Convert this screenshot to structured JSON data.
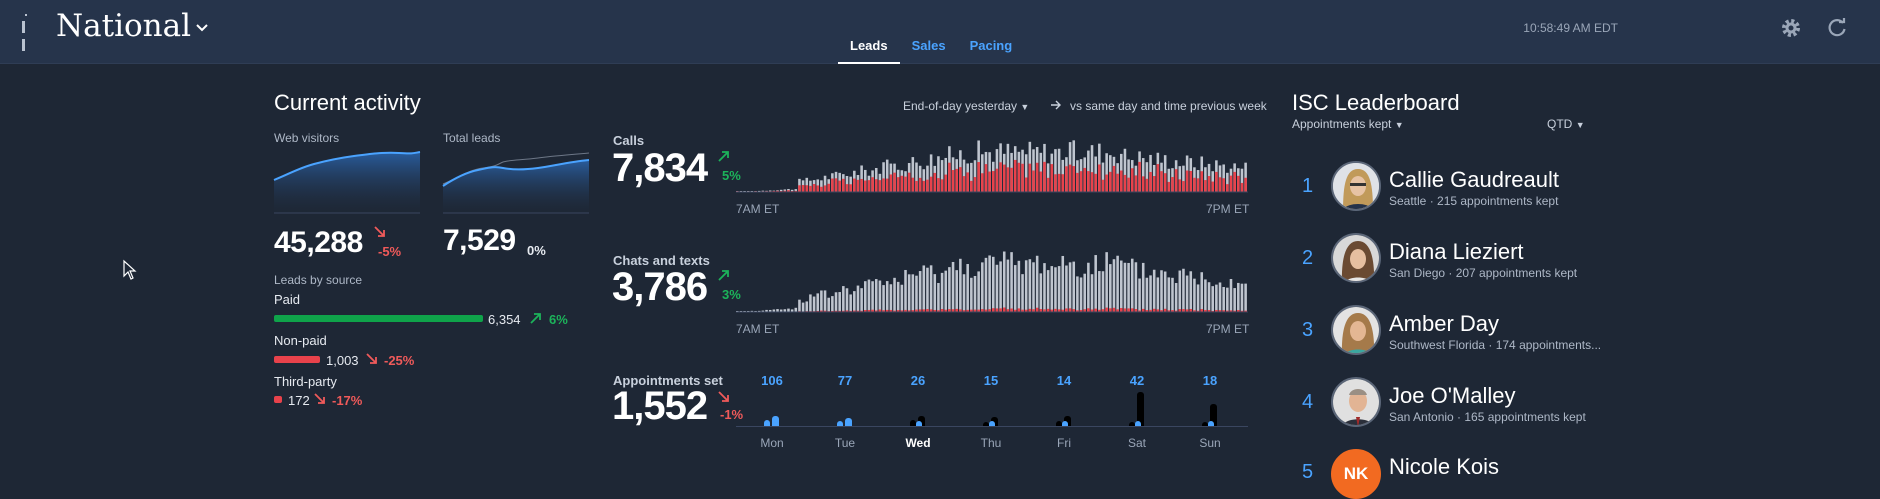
{
  "header": {
    "region": "National",
    "tabs": [
      {
        "label": "Leads",
        "active": true
      },
      {
        "label": "Sales",
        "active": false
      },
      {
        "label": "Pacing",
        "active": false
      }
    ],
    "time": "10:58:49 AM EDT"
  },
  "activity": {
    "title": "Current activity",
    "period": "End-of-day yesterday",
    "comparison": "vs same day and time previous week",
    "web_visitors": {
      "label": "Web visitors",
      "value": "45,288",
      "change": "-5%",
      "trend": "down"
    },
    "total_leads": {
      "label": "Total leads",
      "value": "7,529",
      "change": "0%",
      "trend": "flat"
    },
    "sources_title": "Leads by source",
    "sources": [
      {
        "label": "Paid",
        "value": "6,354",
        "change": "6%",
        "trend": "up",
        "color": "#0fa34a",
        "share": 1.0
      },
      {
        "label": "Non-paid",
        "value": "1,003",
        "change": "-25%",
        "trend": "down",
        "color": "#e8424b",
        "share": 0.22
      },
      {
        "label": "Third-party",
        "value": "172",
        "change": "-17%",
        "trend": "down",
        "color": "#e8424b",
        "share": 0.04
      }
    ],
    "calls": {
      "label": "Calls",
      "value": "7,834",
      "change": "5%",
      "trend": "up",
      "axis_start": "7AM ET",
      "axis_end": "7PM ET"
    },
    "chats": {
      "label": "Chats and texts",
      "value": "3,786",
      "change": "3%",
      "trend": "up",
      "axis_start": "7AM ET",
      "axis_end": "7PM ET"
    },
    "appointments": {
      "label": "Appointments set",
      "value": "1,552",
      "change": "-1%",
      "trend": "down",
      "days": [
        {
          "day": "Mon",
          "count": "106",
          "bold": false
        },
        {
          "day": "Tue",
          "count": "77",
          "bold": false
        },
        {
          "day": "Wed",
          "count": "26",
          "bold": true
        },
        {
          "day": "Thu",
          "count": "15",
          "bold": false
        },
        {
          "day": "Fri",
          "count": "14",
          "bold": false
        },
        {
          "day": "Sat",
          "count": "42",
          "bold": false
        },
        {
          "day": "Sun",
          "count": "18",
          "bold": false
        }
      ]
    }
  },
  "leaderboard": {
    "title": "ISC Leaderboard",
    "metric": "Appointments kept",
    "range": "QTD",
    "entries": [
      {
        "rank": "1",
        "name": "Callie Gaudreault",
        "info": "Seattle · 215 appointments kept"
      },
      {
        "rank": "2",
        "name": "Diana Lieziert",
        "info": "San Diego · 207 appointments kept"
      },
      {
        "rank": "3",
        "name": "Amber Day",
        "info": "Southwest Florida · 174 appointments..."
      },
      {
        "rank": "4",
        "name": "Joe O'Malley",
        "info": "San Antonio · 165 appointments kept"
      },
      {
        "rank": "5",
        "name": "Nicole Kois",
        "info": "",
        "initials": "NK"
      }
    ]
  },
  "colors": {
    "accent": "#4aa3ff",
    "negative": "#f05a5a",
    "positive": "#1cb35a",
    "calls_red": "#e8424b"
  }
}
